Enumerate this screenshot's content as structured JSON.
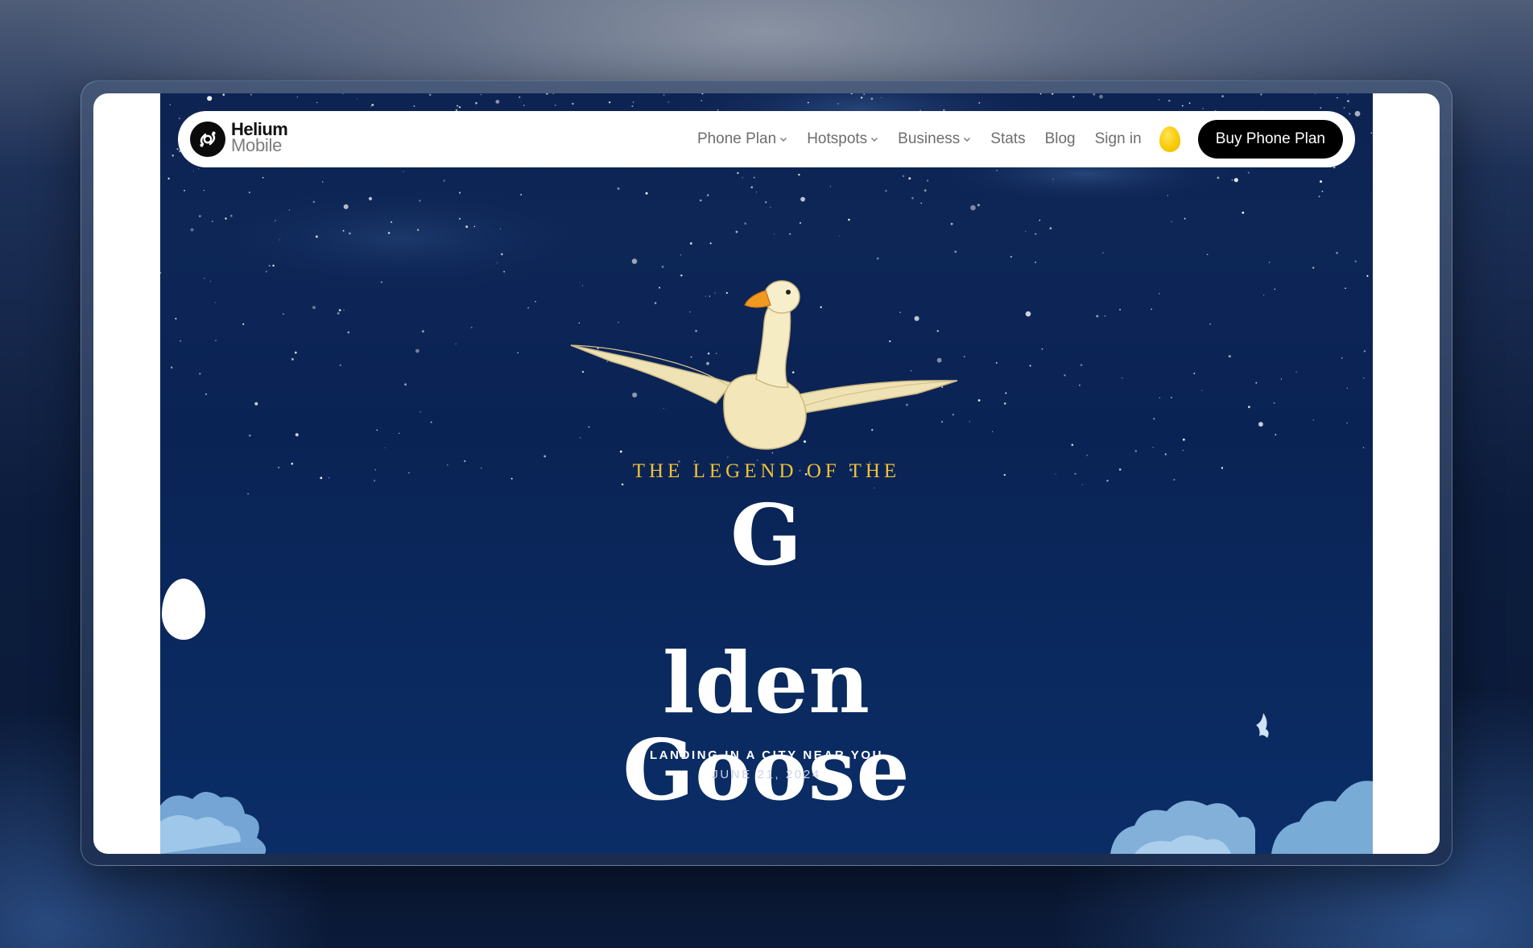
{
  "brand": {
    "line1": "Helium",
    "line2": "Mobile"
  },
  "nav": {
    "items": [
      {
        "label": "Phone Plan",
        "has_dropdown": true
      },
      {
        "label": "Hotspots",
        "has_dropdown": true
      },
      {
        "label": "Business",
        "has_dropdown": true
      },
      {
        "label": "Stats",
        "has_dropdown": false
      },
      {
        "label": "Blog",
        "has_dropdown": false
      },
      {
        "label": "Sign in",
        "has_dropdown": false
      }
    ],
    "egg_icon": "golden-egg-icon",
    "cta_label": "Buy Phone Plan"
  },
  "hero": {
    "subtitle": "THE LEGEND OF THE",
    "title_line1_prefix": "G",
    "title_line1_suffix": "lden",
    "title_line2": "Goose",
    "tagline": "LANDING IN A CITY NEAR YOU",
    "date": "JUNE 21, 2024"
  },
  "colors": {
    "sky": "#0d2352",
    "gold": "#f2c232",
    "egg": "#f7c900",
    "cta": "#000000"
  }
}
